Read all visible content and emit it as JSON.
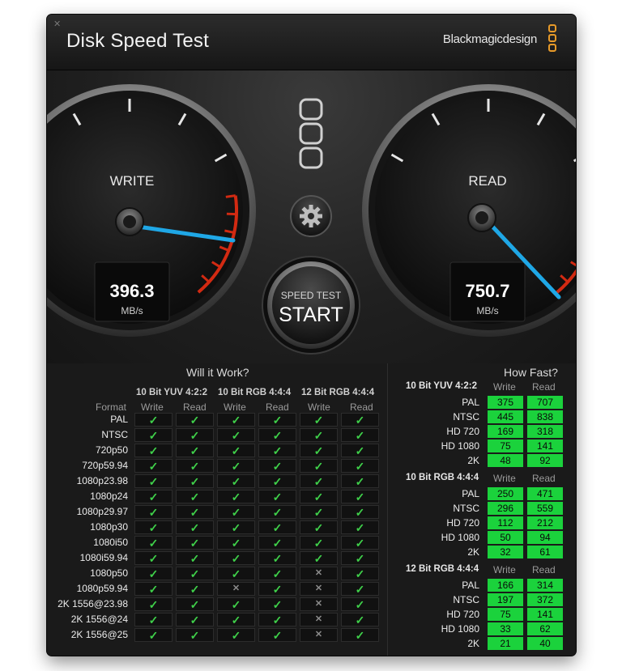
{
  "window": {
    "title": "Disk Speed Test",
    "brand": "Blackmagicdesign",
    "accent": "#e79a29"
  },
  "gauges": {
    "write": {
      "label": "WRITE",
      "value": "396.3",
      "unit": "MB/s",
      "needle_color": "#1fa7e6"
    },
    "read": {
      "label": "READ",
      "value": "750.7",
      "unit": "MB/s",
      "needle_color": "#1fa7e6"
    }
  },
  "controls": {
    "settings_icon": "gear-icon",
    "start_top": "SPEED TEST",
    "start_main": "START"
  },
  "will_it_work": {
    "title": "Will it Work?",
    "format_label": "Format",
    "groups": [
      "10 Bit YUV 4:2:2",
      "10 Bit RGB 4:4:4",
      "12 Bit RGB 4:4:4"
    ],
    "sub_write": "Write",
    "sub_read": "Read",
    "rows": [
      {
        "format": "PAL",
        "cells": [
          1,
          1,
          1,
          1,
          1,
          1
        ]
      },
      {
        "format": "NTSC",
        "cells": [
          1,
          1,
          1,
          1,
          1,
          1
        ]
      },
      {
        "format": "720p50",
        "cells": [
          1,
          1,
          1,
          1,
          1,
          1
        ]
      },
      {
        "format": "720p59.94",
        "cells": [
          1,
          1,
          1,
          1,
          1,
          1
        ]
      },
      {
        "format": "1080p23.98",
        "cells": [
          1,
          1,
          1,
          1,
          1,
          1
        ]
      },
      {
        "format": "1080p24",
        "cells": [
          1,
          1,
          1,
          1,
          1,
          1
        ]
      },
      {
        "format": "1080p29.97",
        "cells": [
          1,
          1,
          1,
          1,
          1,
          1
        ]
      },
      {
        "format": "1080p30",
        "cells": [
          1,
          1,
          1,
          1,
          1,
          1
        ]
      },
      {
        "format": "1080i50",
        "cells": [
          1,
          1,
          1,
          1,
          1,
          1
        ]
      },
      {
        "format": "1080i59.94",
        "cells": [
          1,
          1,
          1,
          1,
          1,
          1
        ]
      },
      {
        "format": "1080p50",
        "cells": [
          1,
          1,
          1,
          1,
          0,
          1
        ]
      },
      {
        "format": "1080p59.94",
        "cells": [
          1,
          1,
          0,
          1,
          0,
          1
        ]
      },
      {
        "format": "2K 1556@23.98",
        "cells": [
          1,
          1,
          1,
          1,
          0,
          1
        ]
      },
      {
        "format": "2K 1556@24",
        "cells": [
          1,
          1,
          1,
          1,
          0,
          1
        ]
      },
      {
        "format": "2K 1556@25",
        "cells": [
          1,
          1,
          1,
          1,
          0,
          1
        ]
      }
    ],
    "yes_color": "#3fd04a",
    "no_color": "#8b8b8b"
  },
  "how_fast": {
    "title": "How Fast?",
    "sub_write": "Write",
    "sub_read": "Read",
    "number_bg": "#1bd23c",
    "groups": [
      {
        "name": "10 Bit YUV 4:2:2",
        "rows": [
          {
            "label": "PAL",
            "write": "375",
            "read": "707"
          },
          {
            "label": "NTSC",
            "write": "445",
            "read": "838"
          },
          {
            "label": "HD 720",
            "write": "169",
            "read": "318"
          },
          {
            "label": "HD 1080",
            "write": "75",
            "read": "141"
          },
          {
            "label": "2K",
            "write": "48",
            "read": "92"
          }
        ]
      },
      {
        "name": "10 Bit RGB 4:4:4",
        "rows": [
          {
            "label": "PAL",
            "write": "250",
            "read": "471"
          },
          {
            "label": "NTSC",
            "write": "296",
            "read": "559"
          },
          {
            "label": "HD 720",
            "write": "112",
            "read": "212"
          },
          {
            "label": "HD 1080",
            "write": "50",
            "read": "94"
          },
          {
            "label": "2K",
            "write": "32",
            "read": "61"
          }
        ]
      },
      {
        "name": "12 Bit RGB 4:4:4",
        "rows": [
          {
            "label": "PAL",
            "write": "166",
            "read": "314"
          },
          {
            "label": "NTSC",
            "write": "197",
            "read": "372"
          },
          {
            "label": "HD 720",
            "write": "75",
            "read": "141"
          },
          {
            "label": "HD 1080",
            "write": "33",
            "read": "62"
          },
          {
            "label": "2K",
            "write": "21",
            "read": "40"
          }
        ]
      }
    ]
  }
}
